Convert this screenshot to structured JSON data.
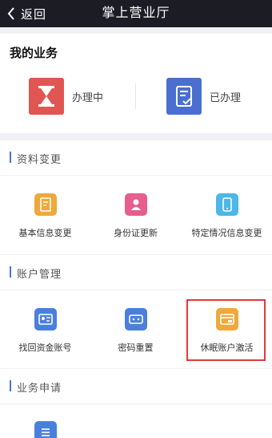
{
  "header": {
    "back_label": "返回",
    "title": "掌上营业厅"
  },
  "my_business": {
    "heading": "我的业务",
    "items": [
      {
        "label": "办理中",
        "icon": "hourglass-icon",
        "color": "#e05652"
      },
      {
        "label": "已办理",
        "icon": "document-check-icon",
        "color": "#4a6fd0"
      }
    ]
  },
  "sections": [
    {
      "title": "资料变更",
      "items": [
        {
          "label": "基本信息变更",
          "icon": "document-edit-icon",
          "color": "#efa93b"
        },
        {
          "label": "身份证更新",
          "icon": "id-person-icon",
          "color": "#e75e8e"
        },
        {
          "label": "特定情况信息变更",
          "icon": "phone-doc-icon",
          "color": "#4cb7e8"
        }
      ]
    },
    {
      "title": "账户管理",
      "items": [
        {
          "label": "找回资金账号",
          "icon": "account-card-icon",
          "color": "#4a80dc"
        },
        {
          "label": "密码重置",
          "icon": "password-icon",
          "color": "#4a80dc"
        },
        {
          "label": "休眠账户激活",
          "icon": "card-activate-icon",
          "color": "#efa93b",
          "highlighted": true
        }
      ]
    },
    {
      "title": "业务申请",
      "items": [
        {
          "label": "",
          "icon": "list-icon",
          "color": "#4a80dc"
        }
      ]
    }
  ]
}
